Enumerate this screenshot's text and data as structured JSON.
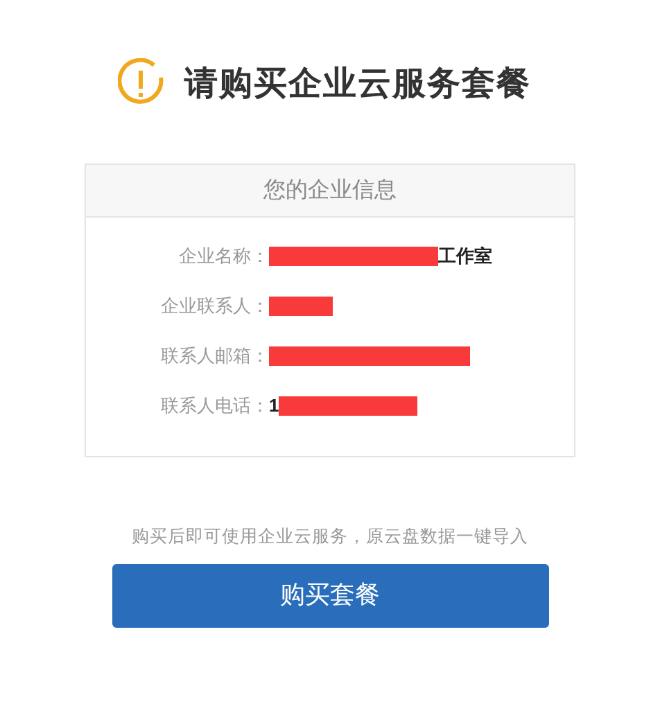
{
  "title": "请购买企业云服务套餐",
  "info_card": {
    "heading": "您的企业信息",
    "fields": [
      {
        "label": "企业名称：",
        "value_after": "工作室"
      },
      {
        "label": "企业联系人："
      },
      {
        "label": "联系人邮箱："
      },
      {
        "label": "联系人电话：",
        "value_before": "1"
      }
    ]
  },
  "note": "购买后即可使用企业云服务，原云盘数据一键导入",
  "buy_button": "购买套餐"
}
